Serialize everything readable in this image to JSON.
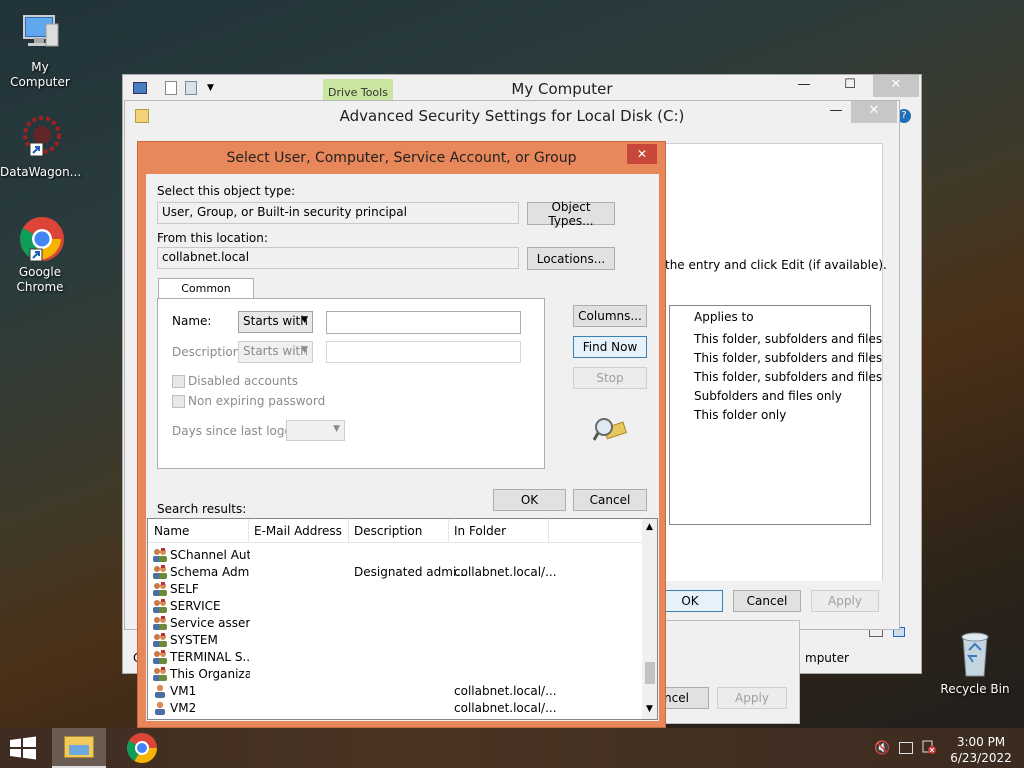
{
  "desktop": {
    "icons": [
      {
        "label": "My Computer"
      },
      {
        "label": "DataWagon..."
      },
      {
        "label": "Google Chrome"
      },
      {
        "label": "Recycle Bin"
      }
    ]
  },
  "explorer": {
    "title": "My Computer",
    "ribbon_tab": "Drive Tools",
    "status_text": "mputer"
  },
  "advanced_security": {
    "title": "Advanced Security Settings for Local Disk (C:)",
    "instruction": "the entry and click Edit (if available).",
    "applies_to_header": "Applies to",
    "applies_to": [
      "This folder, subfolders and files",
      "This folder, subfolders and files",
      "This folder, subfolders and files",
      "Subfolders and files only",
      "This folder only"
    ],
    "ok": "OK",
    "cancel": "Cancel",
    "apply": "Apply"
  },
  "behind_dialog": {
    "cancel": "ncel",
    "apply": "Apply"
  },
  "select_dialog": {
    "title": "Select User, Computer, Service Account, or Group",
    "object_type_label": "Select this object type:",
    "object_type_value": "User, Group, or Built-in security principal",
    "object_types_button": "Object Types...",
    "location_label": "From this location:",
    "location_value": "collabnet.local",
    "locations_button": "Locations...",
    "tab_common_queries": "Common Queries",
    "name_label": "Name:",
    "name_mode": "Starts with",
    "name_value": "",
    "description_label": "Description:",
    "description_mode": "Starts with",
    "description_value": "",
    "disabled_accounts": "Disabled accounts",
    "non_expiring_password": "Non expiring password",
    "days_since_logon": "Days since last logon:",
    "columns_button": "Columns...",
    "find_now_button": "Find Now",
    "stop_button": "Stop",
    "ok_button": "OK",
    "cancel_button": "Cancel",
    "search_results_label": "Search results:",
    "columns": [
      "Name",
      "E-Mail Address",
      "Description",
      "In Folder"
    ],
    "rows": [
      {
        "name": "SChannel Aut...",
        "email": "",
        "description": "",
        "folder": "",
        "icon": "group-icon"
      },
      {
        "name": "Schema Admins",
        "email": "",
        "description": "Designated admi...",
        "folder": "collabnet.local/...",
        "icon": "group-icon"
      },
      {
        "name": "SELF",
        "email": "",
        "description": "",
        "folder": "",
        "icon": "group-icon"
      },
      {
        "name": "SERVICE",
        "email": "",
        "description": "",
        "folder": "",
        "icon": "group-icon"
      },
      {
        "name": "Service assert...",
        "email": "",
        "description": "",
        "folder": "",
        "icon": "group-icon"
      },
      {
        "name": "SYSTEM",
        "email": "",
        "description": "",
        "folder": "",
        "icon": "group-icon"
      },
      {
        "name": "TERMINAL S...",
        "email": "",
        "description": "",
        "folder": "",
        "icon": "group-icon"
      },
      {
        "name": "This Organiza...",
        "email": "",
        "description": "",
        "folder": "",
        "icon": "group-icon"
      },
      {
        "name": "VM1",
        "email": "",
        "description": "",
        "folder": "collabnet.local/...",
        "icon": "user-icon"
      },
      {
        "name": "VM2",
        "email": "",
        "description": "",
        "folder": "collabnet.local/...",
        "icon": "user-icon"
      }
    ]
  },
  "taskbar": {
    "time": "3:00 PM",
    "date": "6/23/2022"
  },
  "colors": {
    "dialog_accent": "#e8875a",
    "focus_blue": "#3c7fb1"
  }
}
